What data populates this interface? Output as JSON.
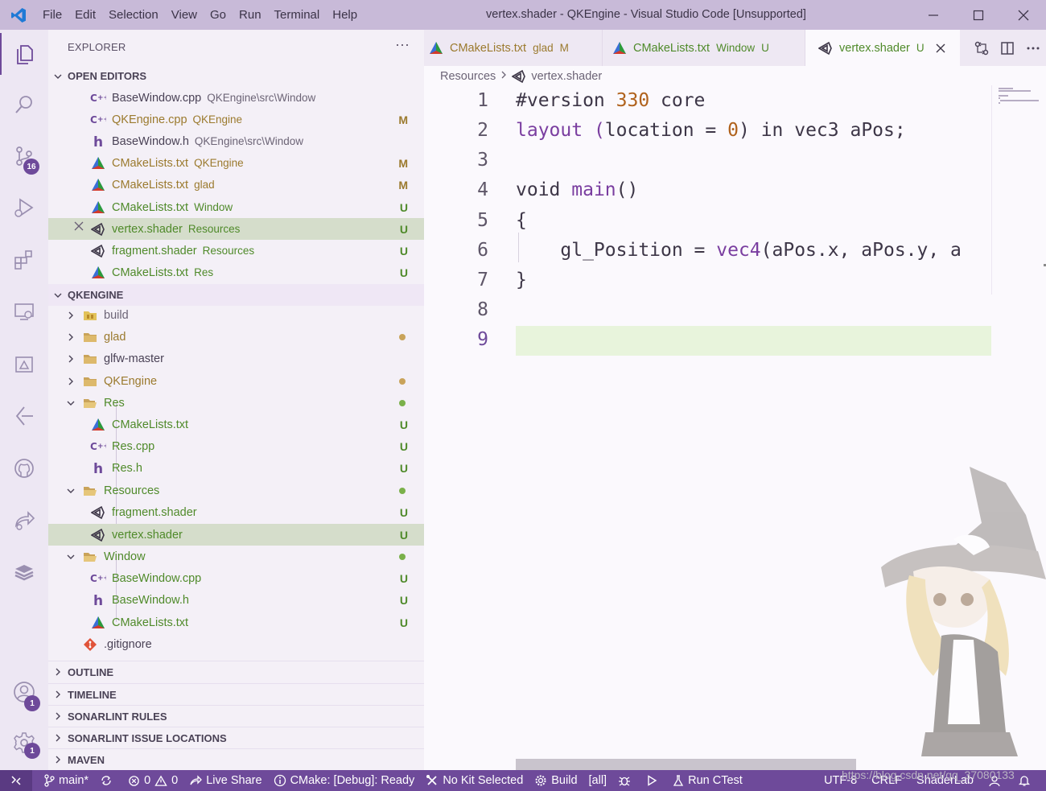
{
  "window": {
    "title": "vertex.shader - QKEngine - Visual Studio Code [Unsupported]",
    "menu": [
      "File",
      "Edit",
      "Selection",
      "View",
      "Go",
      "Run",
      "Terminal",
      "Help"
    ]
  },
  "activity_bar": {
    "scm_badge": "16",
    "accounts_badge": "1",
    "settings_badge": "1"
  },
  "explorer": {
    "title": "EXPLORER",
    "more": "···",
    "open_editors": {
      "header": "OPEN EDITORS",
      "items": [
        {
          "name": "BaseWindow.cpp",
          "desc": "QKEngine\\src\\Window",
          "status": "",
          "icon": "cpp-icon"
        },
        {
          "name": "QKEngine.cpp",
          "desc": "QKEngine",
          "status": "M",
          "icon": "cpp-icon"
        },
        {
          "name": "BaseWindow.h",
          "desc": "QKEngine\\src\\Window",
          "status": "",
          "icon": "header-icon"
        },
        {
          "name": "CMakeLists.txt",
          "desc": "QKEngine",
          "status": "M",
          "icon": "cmake-icon"
        },
        {
          "name": "CMakeLists.txt",
          "desc": "glad",
          "status": "M",
          "icon": "cmake-icon"
        },
        {
          "name": "CMakeLists.txt",
          "desc": "Window",
          "status": "U",
          "icon": "cmake-icon"
        },
        {
          "name": "vertex.shader",
          "desc": "Resources",
          "status": "U",
          "icon": "unity-icon"
        },
        {
          "name": "fragment.shader",
          "desc": "Resources",
          "status": "U",
          "icon": "unity-icon"
        },
        {
          "name": "CMakeLists.txt",
          "desc": "Res",
          "status": "U",
          "icon": "cmake-icon"
        }
      ]
    },
    "project": {
      "header": "QKENGINE",
      "items": [
        {
          "name": "build",
          "status": ""
        },
        {
          "name": "glad",
          "status": "dot"
        },
        {
          "name": "glfw-master",
          "status": ""
        },
        {
          "name": "QKEngine",
          "status": "dot"
        },
        {
          "name": "Res",
          "status": "dot"
        },
        {
          "name": "CMakeLists.txt",
          "status": "U"
        },
        {
          "name": "Res.cpp",
          "status": "U"
        },
        {
          "name": "Res.h",
          "status": "U"
        },
        {
          "name": "Resources",
          "status": "dot"
        },
        {
          "name": "fragment.shader",
          "status": "U"
        },
        {
          "name": "vertex.shader",
          "status": "U"
        },
        {
          "name": "Window",
          "status": "dot"
        },
        {
          "name": "BaseWindow.cpp",
          "status": "U"
        },
        {
          "name": "BaseWindow.h",
          "status": "U"
        },
        {
          "name": "CMakeLists.txt",
          "status": "U"
        },
        {
          "name": ".gitignore",
          "status": ""
        }
      ]
    },
    "collapsed_sections": [
      "OUTLINE",
      "TIMELINE",
      "SONARLINT RULES",
      "SONARLINT ISSUE LOCATIONS",
      "MAVEN"
    ]
  },
  "tabs": [
    {
      "name": "CMakeLists.txt",
      "desc": "glad",
      "status": "M",
      "active": false
    },
    {
      "name": "CMakeLists.txt",
      "desc": "Window",
      "status": "U",
      "active": false
    },
    {
      "name": "vertex.shader",
      "desc": "",
      "status": "U",
      "active": true
    }
  ],
  "breadcrumb": [
    "Resources",
    "vertex.shader"
  ],
  "editor": {
    "line_numbers": [
      "1",
      "2",
      "3",
      "4",
      "5",
      "6",
      "7",
      "8",
      "9"
    ],
    "current_line": "9",
    "code": {
      "l1_a": "#version ",
      "l1_b": "330",
      "l1_c": " core",
      "l2_a": "layout",
      "l2_b": " (",
      "l2_c": "location = ",
      "l2_d": "0",
      "l2_e": ")",
      "l2_f": " in vec3 aPos;",
      "l4_a": "void ",
      "l4_b": "main",
      "l4_c": "()",
      "l5": "{",
      "l6_a": "    gl_Position = ",
      "l6_b": "vec4",
      "l6_c": "(",
      "l6_d": "aPos.x, aPos.y, a",
      "l7": "}"
    }
  },
  "status_bar": {
    "branch": "main*",
    "errors": "0",
    "warnings": "0",
    "live_share": "Live Share",
    "cmake": "CMake: [Debug]: Ready",
    "kit": "No Kit Selected",
    "build": "Build",
    "target": "[all]",
    "run_ctest": "Run CTest",
    "encoding": "UTF-8",
    "eol": "CRLF",
    "language": "ShaderLab"
  },
  "watermark": "https://blog.csdn.net/qq_37080133"
}
